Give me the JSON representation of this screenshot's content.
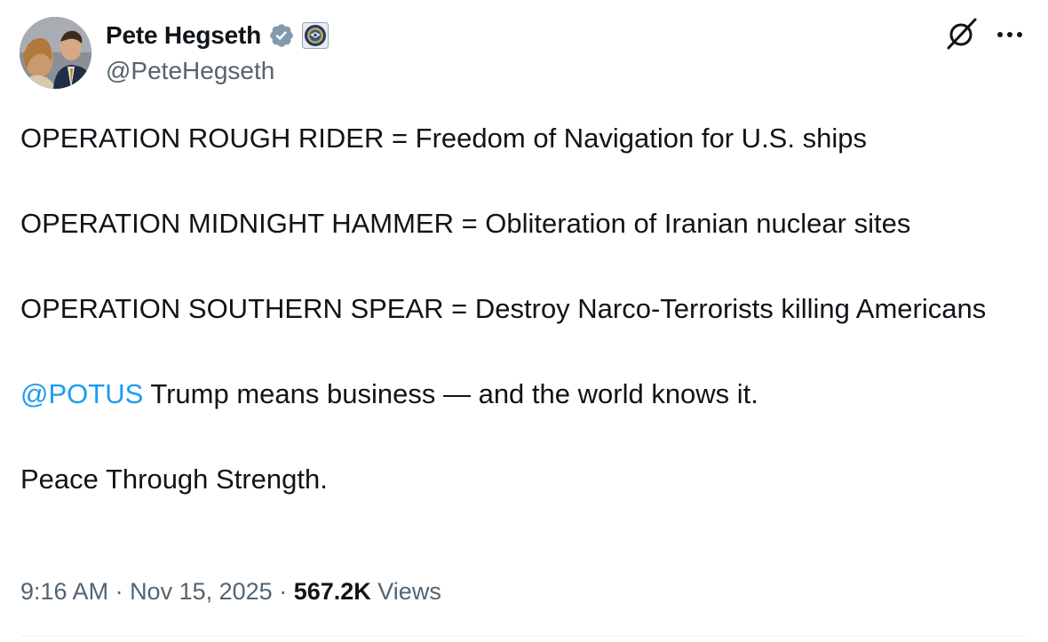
{
  "author": {
    "display_name": "Pete Hegseth",
    "handle": "@PeteHegseth",
    "verified_icon": "verified-badge-icon",
    "affiliate_badge_icon": "dod-seal-icon",
    "verified_color": "#829aab"
  },
  "header_actions": {
    "grok_icon": "grok-icon",
    "more_icon": "more-options-icon"
  },
  "tweet": {
    "line1": "OPERATION ROUGH RIDER = Freedom of Navigation for U.S. ships",
    "line2": "OPERATION MIDNIGHT HAMMER = Obliteration of Iranian nuclear sites",
    "line3": "OPERATION SOUTHERN SPEAR = Destroy Narco-Terrorists killing Americans",
    "mention": "@POTUS",
    "line4_rest": " Trump means business — and the world knows it.",
    "line5": "Peace Through Strength."
  },
  "meta": {
    "time": "9:16 AM",
    "separator": " · ",
    "date": "Nov 15, 2025",
    "views_count": "567.2K",
    "views_label": "Views"
  },
  "colors": {
    "text": "#0f1419",
    "secondary": "#536471",
    "link": "#1d9bf0"
  }
}
